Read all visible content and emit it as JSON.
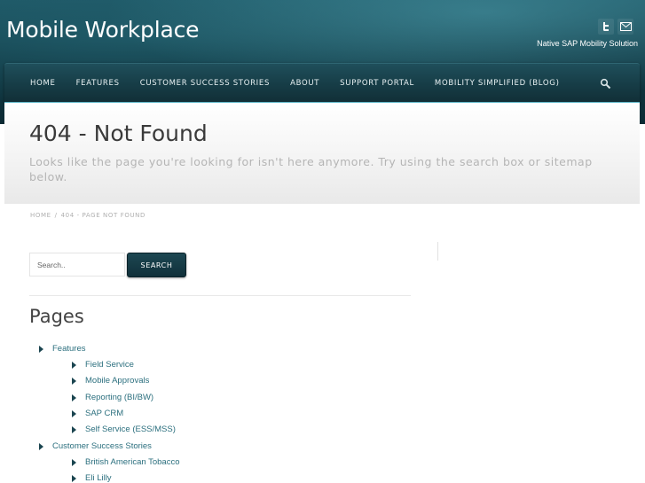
{
  "header": {
    "site_title": "Mobile Workplace",
    "tagline": "Native SAP Mobility Solution",
    "social": [
      {
        "name": "twitter-icon"
      },
      {
        "name": "mail-icon"
      }
    ]
  },
  "nav": {
    "items": [
      {
        "label": "HOME"
      },
      {
        "label": "FEATURES"
      },
      {
        "label": "CUSTOMER SUCCESS STORIES"
      },
      {
        "label": "ABOUT"
      },
      {
        "label": "SUPPORT PORTAL"
      },
      {
        "label": "MOBILITY SIMPLIFIED (BLOG)"
      }
    ]
  },
  "page": {
    "title": "404 - Not Found",
    "subtitle": "Looks like the page you're looking for isn't here anymore. Try using the search box or sitemap below."
  },
  "breadcrumb": {
    "home": "HOME",
    "separator": "/",
    "current": "404 - PAGE NOT FOUND"
  },
  "search": {
    "placeholder": "Search..",
    "button_label": "SEARCH"
  },
  "pages": {
    "heading": "Pages",
    "items": [
      {
        "label": "Features",
        "level": 1
      },
      {
        "label": "Field Service",
        "level": 2
      },
      {
        "label": "Mobile Approvals",
        "level": 2
      },
      {
        "label": "Reporting (BI/BW)",
        "level": 2
      },
      {
        "label": "SAP CRM",
        "level": 2
      },
      {
        "label": "Self Service (ESS/MSS)",
        "level": 2
      },
      {
        "label": "Customer Success Stories",
        "level": 1
      },
      {
        "label": "British American Tobacco",
        "level": 2
      },
      {
        "label": "Eli Lilly",
        "level": 2
      }
    ]
  },
  "colors": {
    "link": "#2b6f7e",
    "nav_accent": "#5fb6c8",
    "header_dark": "#0c2a33"
  }
}
